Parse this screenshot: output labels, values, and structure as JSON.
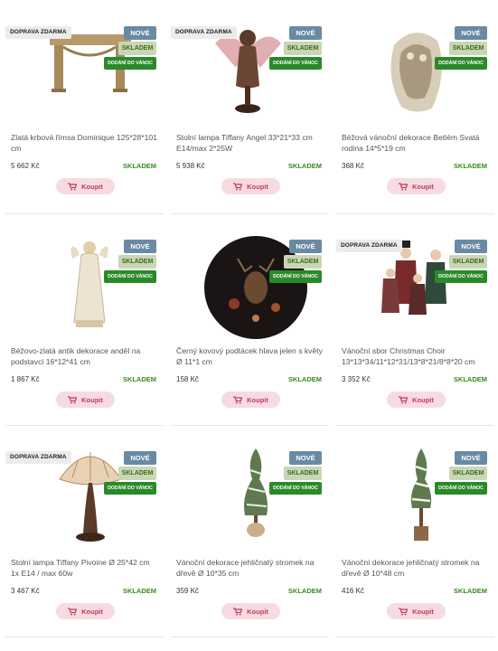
{
  "labels": {
    "free_shipping": "DOPRAVA ZDARMA",
    "new": "NOVÉ",
    "in_stock_badge": "SKLADEM",
    "christmas": "DODÁNÍ DO VÁNOC",
    "buy": "Koupit"
  },
  "products": [
    {
      "name": "Zlatá krbová římsa Dominique 125*28*101 cm",
      "price": "5 662 Kč",
      "stock": "SKLADEM",
      "free_shipping": true
    },
    {
      "name": "Stolní lampa Tiffany Angel 33*21*33 cm E14/max 2*25W",
      "price": "5 938 Kč",
      "stock": "SKLADEM",
      "free_shipping": true
    },
    {
      "name": "Béžová vánoční dekorace Betlém Svatá rodina 14*5*19 cm",
      "price": "368 Kč",
      "stock": "SKLADEM",
      "free_shipping": false
    },
    {
      "name": "Béžovo-zlatá antik dekorace anděl na podstavci 16*12*41 cm",
      "price": "1 867 Kč",
      "stock": "SKLADEM",
      "free_shipping": false
    },
    {
      "name": "Černý kovový podtácek hlava jelen s květy Ø 11*1 cm",
      "price": "158 Kč",
      "stock": "SKLADEM",
      "free_shipping": false
    },
    {
      "name": "Vánoční sbor Christmas Choir 13*13*34/11*12*31/13*8*21/8*8*20 cm",
      "price": "3 352 Kč",
      "stock": "SKLADEM",
      "free_shipping": true
    },
    {
      "name": "Stolní lampa Tiffany Pivoine Ø 25*42 cm 1x E14 / max 60w",
      "price": "3 467 Kč",
      "stock": "SKLADEM",
      "free_shipping": true
    },
    {
      "name": "Vánoční dekorace jehličnatý stromek na dřevě Ø 10*35 cm",
      "price": "359 Kč",
      "stock": "SKLADEM",
      "free_shipping": false
    },
    {
      "name": "Vánoční dekorace jehličnatý stromek na dřevě Ø 10*48 cm",
      "price": "416 Kč",
      "stock": "SKLADEM",
      "free_shipping": false
    }
  ],
  "colors": {
    "new_badge": "#6a8aa3",
    "stock_badge": "#c9d6b6",
    "christmas_badge": "#2a8a2a",
    "buy_button": "#f7dbe3",
    "stock_text": "#3c8a1e"
  }
}
